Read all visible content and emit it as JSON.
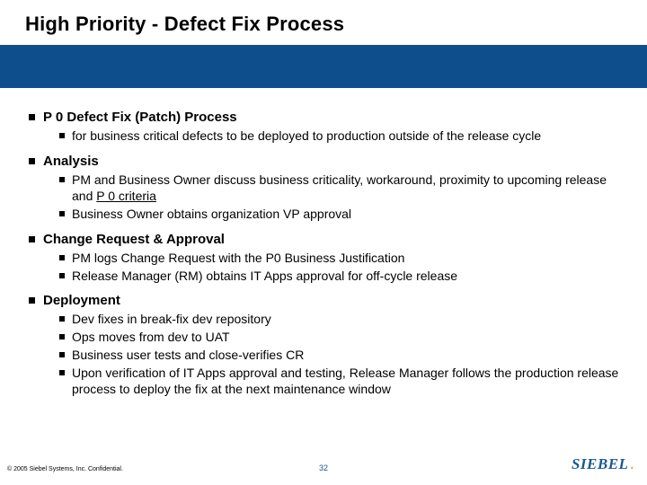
{
  "title": "High Priority - Defect Fix Process",
  "sections": [
    {
      "heading": "P 0 Defect Fix (Patch) Process",
      "items": [
        {
          "text": "for business critical defects to be deployed to production outside of the release cycle"
        }
      ]
    },
    {
      "heading": "Analysis",
      "items": [
        {
          "pre": "PM and Business Owner discuss business criticality, workaround, proximity to upcoming release and ",
          "underline": "P 0 criteria"
        },
        {
          "text": "Business Owner obtains organization VP approval"
        }
      ]
    },
    {
      "heading": "Change Request & Approval",
      "items": [
        {
          "text": "PM logs Change Request with the P0 Business Justification"
        },
        {
          "text": "Release Manager (RM) obtains IT Apps approval for off-cycle release"
        }
      ]
    },
    {
      "heading": "Deployment",
      "items": [
        {
          "text": "Dev fixes in break-fix dev repository"
        },
        {
          "text": "Ops moves from dev to UAT"
        },
        {
          "text": "Business user tests and close-verifies CR"
        },
        {
          "text": "Upon verification of IT Apps approval and testing, Release Manager follows the production release process to deploy the fix at the next maintenance window"
        }
      ]
    }
  ],
  "footer": {
    "copyright": "© 2005 Siebel Systems, Inc. Confidential.",
    "page": "32",
    "logo": "SIEBEL"
  }
}
